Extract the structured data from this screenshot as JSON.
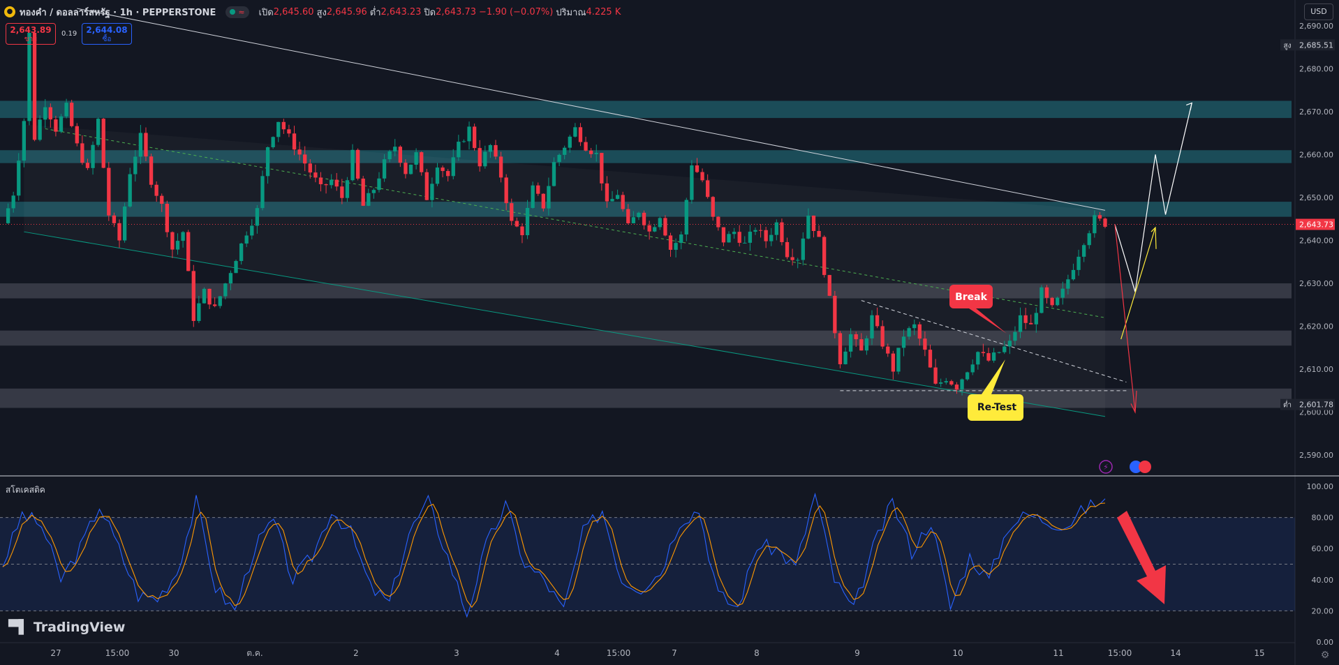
{
  "header": {
    "symbol_title": "ทองคำ / ดอลลาร์สหรัฐ · 1h · PEPPERSTONE",
    "ohlc": {
      "open_label": "เปิด",
      "open": "2,645.60",
      "high_label": "สูง",
      "high": "2,645.96",
      "low_label": "ต่ำ",
      "low": "2,643.23",
      "close_label": "ปิด",
      "close": "2,643.73",
      "change": "−1.90 (−0.07%)",
      "volume_label": "ปริมาณ",
      "volume": "4.225 K"
    },
    "sell": {
      "price": "2,643.89",
      "label": "ขาย"
    },
    "buy": {
      "price": "2,644.08",
      "label": "ซื้อ"
    },
    "spread": "0.19",
    "currency": "USD"
  },
  "price_axis": {
    "ticks": [
      "2,690.00",
      "2,680.00",
      "2,670.00",
      "2,660.00",
      "2,650.00",
      "2,640.00",
      "2,630.00",
      "2,620.00",
      "2,610.00",
      "2,600.00",
      "2,590.00"
    ],
    "high_marker": {
      "label": "สูง",
      "value": "2,685.51"
    },
    "low_marker": {
      "label": "ต่ำ",
      "value": "2,601.78"
    },
    "last_price": "2,643.73"
  },
  "time_axis": [
    "27",
    "15:00",
    "30",
    "ต.ค.",
    "2",
    "3",
    "4",
    "15:00",
    "7",
    "8",
    "9",
    "10",
    "11",
    "15:00",
    "14",
    "15"
  ],
  "annotations": {
    "break": "Break",
    "retest": "Re-Test"
  },
  "indicator": {
    "title": "สโตเคสติค",
    "ticks": [
      "100.00",
      "80.00",
      "60.00",
      "40.00",
      "20.00",
      "0.00"
    ]
  },
  "brand": "TradingView",
  "colors": {
    "bull": "#089981",
    "bear": "#f23645",
    "k_line": "#2962ff",
    "d_line": "#ff9800",
    "zone_teal": "#1f5f6b",
    "zone_grey": "#434651",
    "background": "#131722"
  },
  "chart_data": {
    "type": "candlestick",
    "xlabel": "",
    "ylabel": "",
    "ylim": [
      2585,
      2695
    ],
    "grid": false,
    "resistance_zones": [
      [
        2668.5,
        2672.5
      ],
      [
        2658.0,
        2661.0
      ],
      [
        2645.5,
        2649.0
      ]
    ],
    "support_zones": [
      [
        2626.5,
        2630.0
      ],
      [
        2615.5,
        2619.0
      ],
      [
        2601.0,
        2605.5
      ]
    ],
    "price_path": [
      [
        0,
        2644
      ],
      [
        2,
        2651
      ],
      [
        4,
        2668
      ],
      [
        5,
        2688
      ],
      [
        6,
        2664
      ],
      [
        8,
        2672
      ],
      [
        10,
        2666
      ],
      [
        12,
        2671
      ],
      [
        14,
        2662
      ],
      [
        16,
        2656
      ],
      [
        18,
        2668
      ],
      [
        20,
        2646
      ],
      [
        22,
        2640
      ],
      [
        24,
        2656
      ],
      [
        26,
        2664
      ],
      [
        28,
        2654
      ],
      [
        30,
        2648
      ],
      [
        32,
        2638
      ],
      [
        34,
        2642
      ],
      [
        36,
        2622
      ],
      [
        38,
        2628
      ],
      [
        40,
        2624
      ],
      [
        42,
        2630
      ],
      [
        44,
        2636
      ],
      [
        46,
        2642
      ],
      [
        48,
        2647
      ],
      [
        50,
        2662
      ],
      [
        52,
        2668
      ],
      [
        54,
        2664
      ],
      [
        56,
        2660
      ],
      [
        58,
        2656
      ],
      [
        60,
        2652
      ],
      [
        62,
        2654
      ],
      [
        64,
        2650
      ],
      [
        66,
        2660
      ],
      [
        68,
        2648
      ],
      [
        70,
        2652
      ],
      [
        72,
        2658
      ],
      [
        74,
        2662
      ],
      [
        76,
        2656
      ],
      [
        78,
        2660
      ],
      [
        80,
        2650
      ],
      [
        82,
        2658
      ],
      [
        84,
        2655
      ],
      [
        86,
        2662
      ],
      [
        88,
        2666
      ],
      [
        90,
        2658
      ],
      [
        92,
        2662
      ],
      [
        94,
        2655
      ],
      [
        96,
        2644
      ],
      [
        98,
        2642
      ],
      [
        100,
        2652
      ],
      [
        102,
        2648
      ],
      [
        104,
        2658
      ],
      [
        106,
        2662
      ],
      [
        108,
        2666
      ],
      [
        110,
        2662
      ],
      [
        112,
        2660
      ],
      [
        114,
        2648
      ],
      [
        116,
        2651
      ],
      [
        118,
        2643
      ],
      [
        120,
        2647
      ],
      [
        122,
        2642
      ],
      [
        124,
        2646
      ],
      [
        126,
        2638
      ],
      [
        128,
        2641
      ],
      [
        130,
        2658
      ],
      [
        132,
        2654
      ],
      [
        134,
        2645
      ],
      [
        136,
        2640
      ],
      [
        138,
        2642
      ],
      [
        140,
        2639
      ],
      [
        142,
        2643
      ],
      [
        144,
        2640
      ],
      [
        146,
        2644
      ],
      [
        148,
        2637
      ],
      [
        150,
        2636
      ],
      [
        152,
        2646
      ],
      [
        154,
        2640
      ],
      [
        156,
        2626
      ],
      [
        158,
        2612
      ],
      [
        160,
        2618
      ],
      [
        162,
        2614
      ],
      [
        164,
        2622
      ],
      [
        166,
        2616
      ],
      [
        168,
        2610
      ],
      [
        170,
        2618
      ],
      [
        172,
        2620
      ],
      [
        174,
        2614
      ],
      [
        176,
        2606
      ],
      [
        178,
        2608
      ],
      [
        180,
        2606
      ],
      [
        182,
        2610
      ],
      [
        184,
        2614
      ],
      [
        186,
        2612
      ],
      [
        188,
        2614
      ],
      [
        190,
        2616
      ],
      [
        192,
        2622
      ],
      [
        194,
        2620
      ],
      [
        196,
        2628
      ],
      [
        198,
        2624
      ],
      [
        200,
        2628
      ],
      [
        202,
        2634
      ],
      [
        204,
        2640
      ],
      [
        206,
        2645
      ],
      [
        208,
        2644
      ]
    ],
    "projection_path": [
      [
        2643.7,
        0
      ],
      [
        2628,
        10
      ],
      [
        2660,
        20
      ],
      [
        2646,
        25
      ],
      [
        2672,
        38
      ]
    ],
    "stochastic": {
      "k_period": "14",
      "overbought": 80,
      "oversold": 20,
      "k_shape": [
        50,
        82,
        75,
        40,
        60,
        88,
        60,
        30,
        28,
        45,
        90,
        35,
        20,
        60,
        78,
        40,
        55,
        85,
        70,
        35,
        25,
        70,
        90,
        55,
        18,
        62,
        88,
        50,
        40,
        20,
        70,
        85,
        40,
        35,
        45,
        78,
        85,
        30,
        22,
        62,
        60,
        48,
        95,
        40,
        20,
        60,
        90,
        58,
        78,
        22,
        55,
        40,
        75,
        82,
        78,
        75,
        86,
        92
      ]
    },
    "type_note": "candlestick"
  }
}
